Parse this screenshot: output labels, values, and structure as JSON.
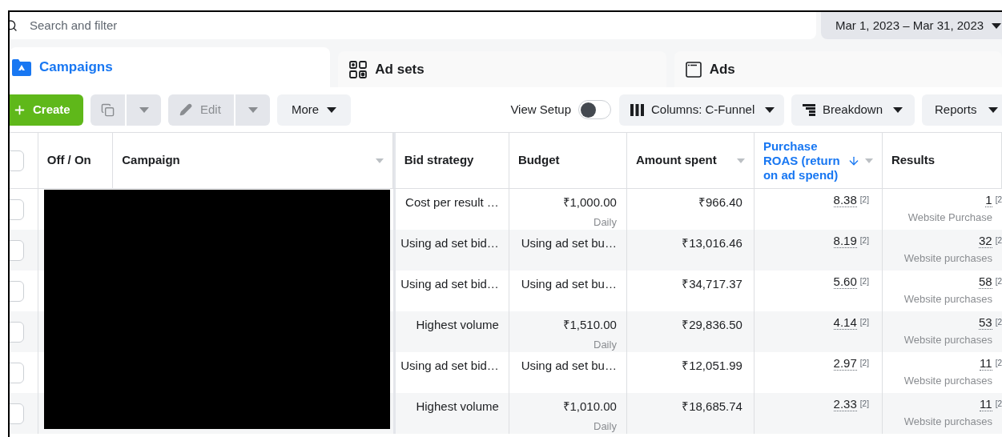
{
  "search": {
    "placeholder": "Search and filter"
  },
  "date_range": "Mar 1, 2023 – Mar 31, 2023",
  "tabs": [
    {
      "label": "Campaigns",
      "selected": true,
      "kind": "folder"
    },
    {
      "label": "Ad sets",
      "selected": false,
      "kind": "grid"
    },
    {
      "label": "Ads",
      "selected": false,
      "kind": "window"
    }
  ],
  "toolbar": {
    "create": "Create",
    "edit": "Edit",
    "more": "More",
    "view_setup": {
      "label": "View Setup",
      "on": false
    },
    "columns": "Columns: C-Funnel",
    "breakdown": "Breakdown",
    "reports": "Reports"
  },
  "table": {
    "select_all_checked": false,
    "columns": [
      {
        "label": "Off / On",
        "sorted": false,
        "menu": false
      },
      {
        "label": "Campaign",
        "sorted": false,
        "menu": true
      },
      {
        "label": "Bid strategy",
        "sorted": false,
        "menu": false
      },
      {
        "label": "Budget",
        "sorted": false,
        "menu": false
      },
      {
        "label": "Amount spent",
        "sorted": false,
        "menu": true
      },
      {
        "label": "Purchase ROAS (return on ad spend)",
        "sorted": true,
        "menu": true
      },
      {
        "label": "Results",
        "sorted": false,
        "menu": false
      }
    ],
    "rows": [
      {
        "checked": false,
        "bid_strategy": "Cost per result …",
        "budget": "₹1,000.00",
        "budget_period": "Daily",
        "amount_spent": "₹966.40",
        "roas": "8.38",
        "roas_note": "[2]",
        "results": "1",
        "results_note": "[2",
        "result_type": "Website Purchase"
      },
      {
        "checked": false,
        "bid_strategy": "Using ad set bid…",
        "budget": "Using ad set bu…",
        "amount_spent": "₹13,016.46",
        "roas": "8.19",
        "roas_note": "[2]",
        "results": "32",
        "results_note": "[2",
        "result_type": "Website purchases"
      },
      {
        "checked": false,
        "bid_strategy": "Using ad set bid…",
        "budget": "Using ad set bu…",
        "amount_spent": "₹34,717.37",
        "roas": "5.60",
        "roas_note": "[2]",
        "results": "58",
        "results_note": "[2",
        "result_type": "Website purchases"
      },
      {
        "checked": false,
        "bid_strategy": "Highest volume",
        "budget": "₹1,510.00",
        "budget_period": "Daily",
        "amount_spent": "₹29,836.50",
        "roas": "4.14",
        "roas_note": "[2]",
        "results": "53",
        "results_note": "[2",
        "result_type": "Website purchases"
      },
      {
        "checked": false,
        "bid_strategy": "Using ad set bid…",
        "budget": "Using ad set bu…",
        "amount_spent": "₹12,051.99",
        "roas": "2.97",
        "roas_note": "[2]",
        "results": "11",
        "results_note": "[2",
        "result_type": "Website purchases"
      },
      {
        "checked": false,
        "bid_strategy": "Highest volume",
        "budget": "₹1,010.00",
        "budget_period": "Daily",
        "amount_spent": "₹18,685.74",
        "roas": "2.33",
        "roas_note": "[2]",
        "results": "11",
        "results_note": "[2",
        "result_type": "Website purchases"
      }
    ]
  }
}
